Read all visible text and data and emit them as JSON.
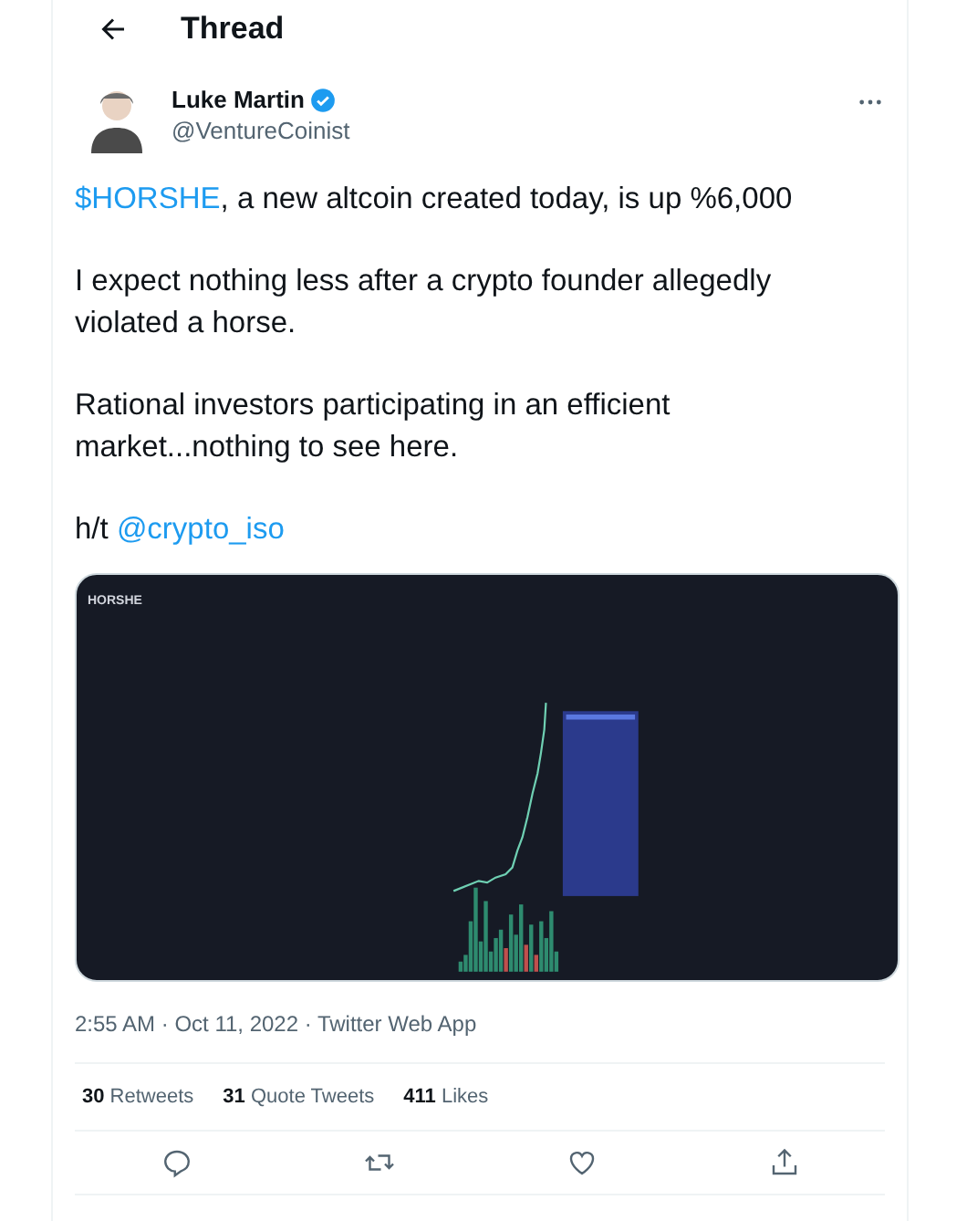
{
  "header": {
    "title": "Thread"
  },
  "author": {
    "name": "Luke Martin",
    "verified": true,
    "handle": "@VentureCoinist"
  },
  "paragraphs": [
    [
      {
        "kind": "link",
        "text": "$HORSHE"
      },
      {
        "kind": "text",
        "text": ", a new altcoin created today, is up %6,000"
      }
    ],
    [
      {
        "kind": "text",
        "text": "I expect nothing less after a crypto founder allegedly violated a horse."
      }
    ],
    [
      {
        "kind": "text",
        "text": "Rational investors participating in an efficient market...nothing to see here."
      }
    ],
    [
      {
        "kind": "text",
        "text": "h/t "
      },
      {
        "kind": "link",
        "text": "@crypto_iso"
      }
    ]
  ],
  "media": {
    "symbol": "HORSHE"
  },
  "meta": "2:55 AM · Oct 11, 2022 · Twitter Web App",
  "stats": [
    {
      "count": "30",
      "label": "Retweets"
    },
    {
      "count": "31",
      "label": "Quote Tweets"
    },
    {
      "count": "411",
      "label": "Likes"
    }
  ],
  "actions": [
    {
      "kind": "reply"
    },
    {
      "kind": "retweet"
    },
    {
      "kind": "like"
    },
    {
      "kind": "share"
    }
  ]
}
